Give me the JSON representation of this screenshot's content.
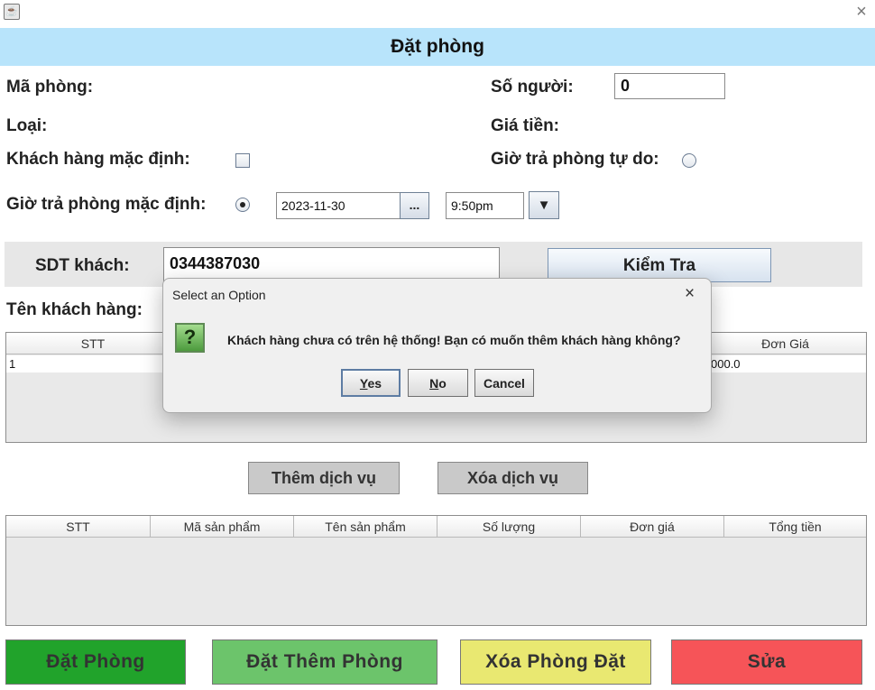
{
  "window": {
    "icon": "java-app-icon",
    "close_icon": "×"
  },
  "header": {
    "title": "Đặt phòng"
  },
  "form": {
    "ma_phong_label": "Mã phòng:",
    "so_nguoi_label": "Số người:",
    "so_nguoi_value": "0",
    "loai_label": "Loại:",
    "gia_tien_label": "Giá tiền:",
    "khach_mac_dinh_label": "Khách hàng mặc định:",
    "khach_mac_dinh_checked": false,
    "gio_tra_tu_do_label": "Giờ trả phòng tự do:",
    "gio_tra_tu_do_selected": false,
    "gio_tra_mac_dinh_label": "Giờ trả phòng mặc định:",
    "gio_tra_mac_dinh_selected": true,
    "date_value": "2023-11-30",
    "date_button": "...",
    "time_value": "9:50pm",
    "time_dropdown_icon": "▼",
    "sdt_label": "SDT khách:",
    "sdt_value": "0344387030",
    "kiem_tra_button": "Kiểm Tra",
    "ten_khach_label": "Tên khách hàng:"
  },
  "room_table": {
    "headers": [
      "STT",
      "Đơn Giá"
    ],
    "rows": [
      {
        "stt": "1",
        "don_gia": "000.0"
      }
    ]
  },
  "service_buttons": {
    "them": "Thêm dịch vụ",
    "xoa": "Xóa dịch vụ"
  },
  "service_table": {
    "headers": [
      "STT",
      "Mã sản phẩm",
      "Tên sản phẩm",
      "Số lượng",
      "Đơn giá",
      "Tổng tiền"
    ]
  },
  "actions": {
    "dat_phong": "Đặt Phòng",
    "dat_them_phong": "Đặt Thêm Phòng",
    "xoa_phong_dat": "Xóa Phòng Đặt",
    "sua": "Sửa",
    "colors": {
      "dat_phong": "#21a32b",
      "dat_them_phong": "#6cc46b",
      "xoa_phong_dat": "#e9e871",
      "sua": "#f65458"
    }
  },
  "dialog": {
    "title": "Select an Option",
    "close_icon": "×",
    "icon": "question-icon",
    "icon_glyph": "?",
    "message": "Khách hàng chưa có trên hệ thống! Bạn có muốn thêm khách hàng không?",
    "buttons": {
      "yes": "Yes",
      "no": "No",
      "cancel": "Cancel"
    },
    "buttons_mnemonic": {
      "yes_first": "Y",
      "yes_rest": "es",
      "no_first": "N",
      "no_rest": "o"
    }
  }
}
